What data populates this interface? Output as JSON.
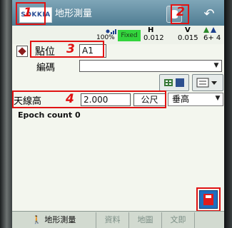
{
  "title_bar": {
    "brand": "SOKKIA",
    "title": "地形測量",
    "db_icon": "database-icon",
    "back_icon": "back-arrow-icon"
  },
  "status_bar": {
    "percent": "100%",
    "solution": "Fixed",
    "h_label": "H",
    "h_value": "0.012",
    "v_label": "V",
    "v_value": "0.015",
    "sat_count": "6+ 4"
  },
  "form": {
    "point_label": "點位",
    "point_value": "A1",
    "code_label": "編碼",
    "code_value": "",
    "antenna_label": "天線高",
    "antenna_value": "2.000",
    "antenna_unit": "公尺",
    "antenna_mode": "垂高",
    "epoch_text": "Epoch count 0"
  },
  "annotations": [
    "1",
    "2",
    "3",
    "4"
  ],
  "tabs": [
    {
      "label": "地形測量",
      "active": true
    },
    {
      "label": "資料",
      "active": false
    },
    {
      "label": "地圖",
      "active": false
    },
    {
      "label": "文即",
      "active": false
    }
  ],
  "colors": {
    "title_bar": "#5d8aa0",
    "fixed_badge": "#33d43d",
    "annotation_red": "#e01313",
    "save_button": "#1e6fbf"
  }
}
